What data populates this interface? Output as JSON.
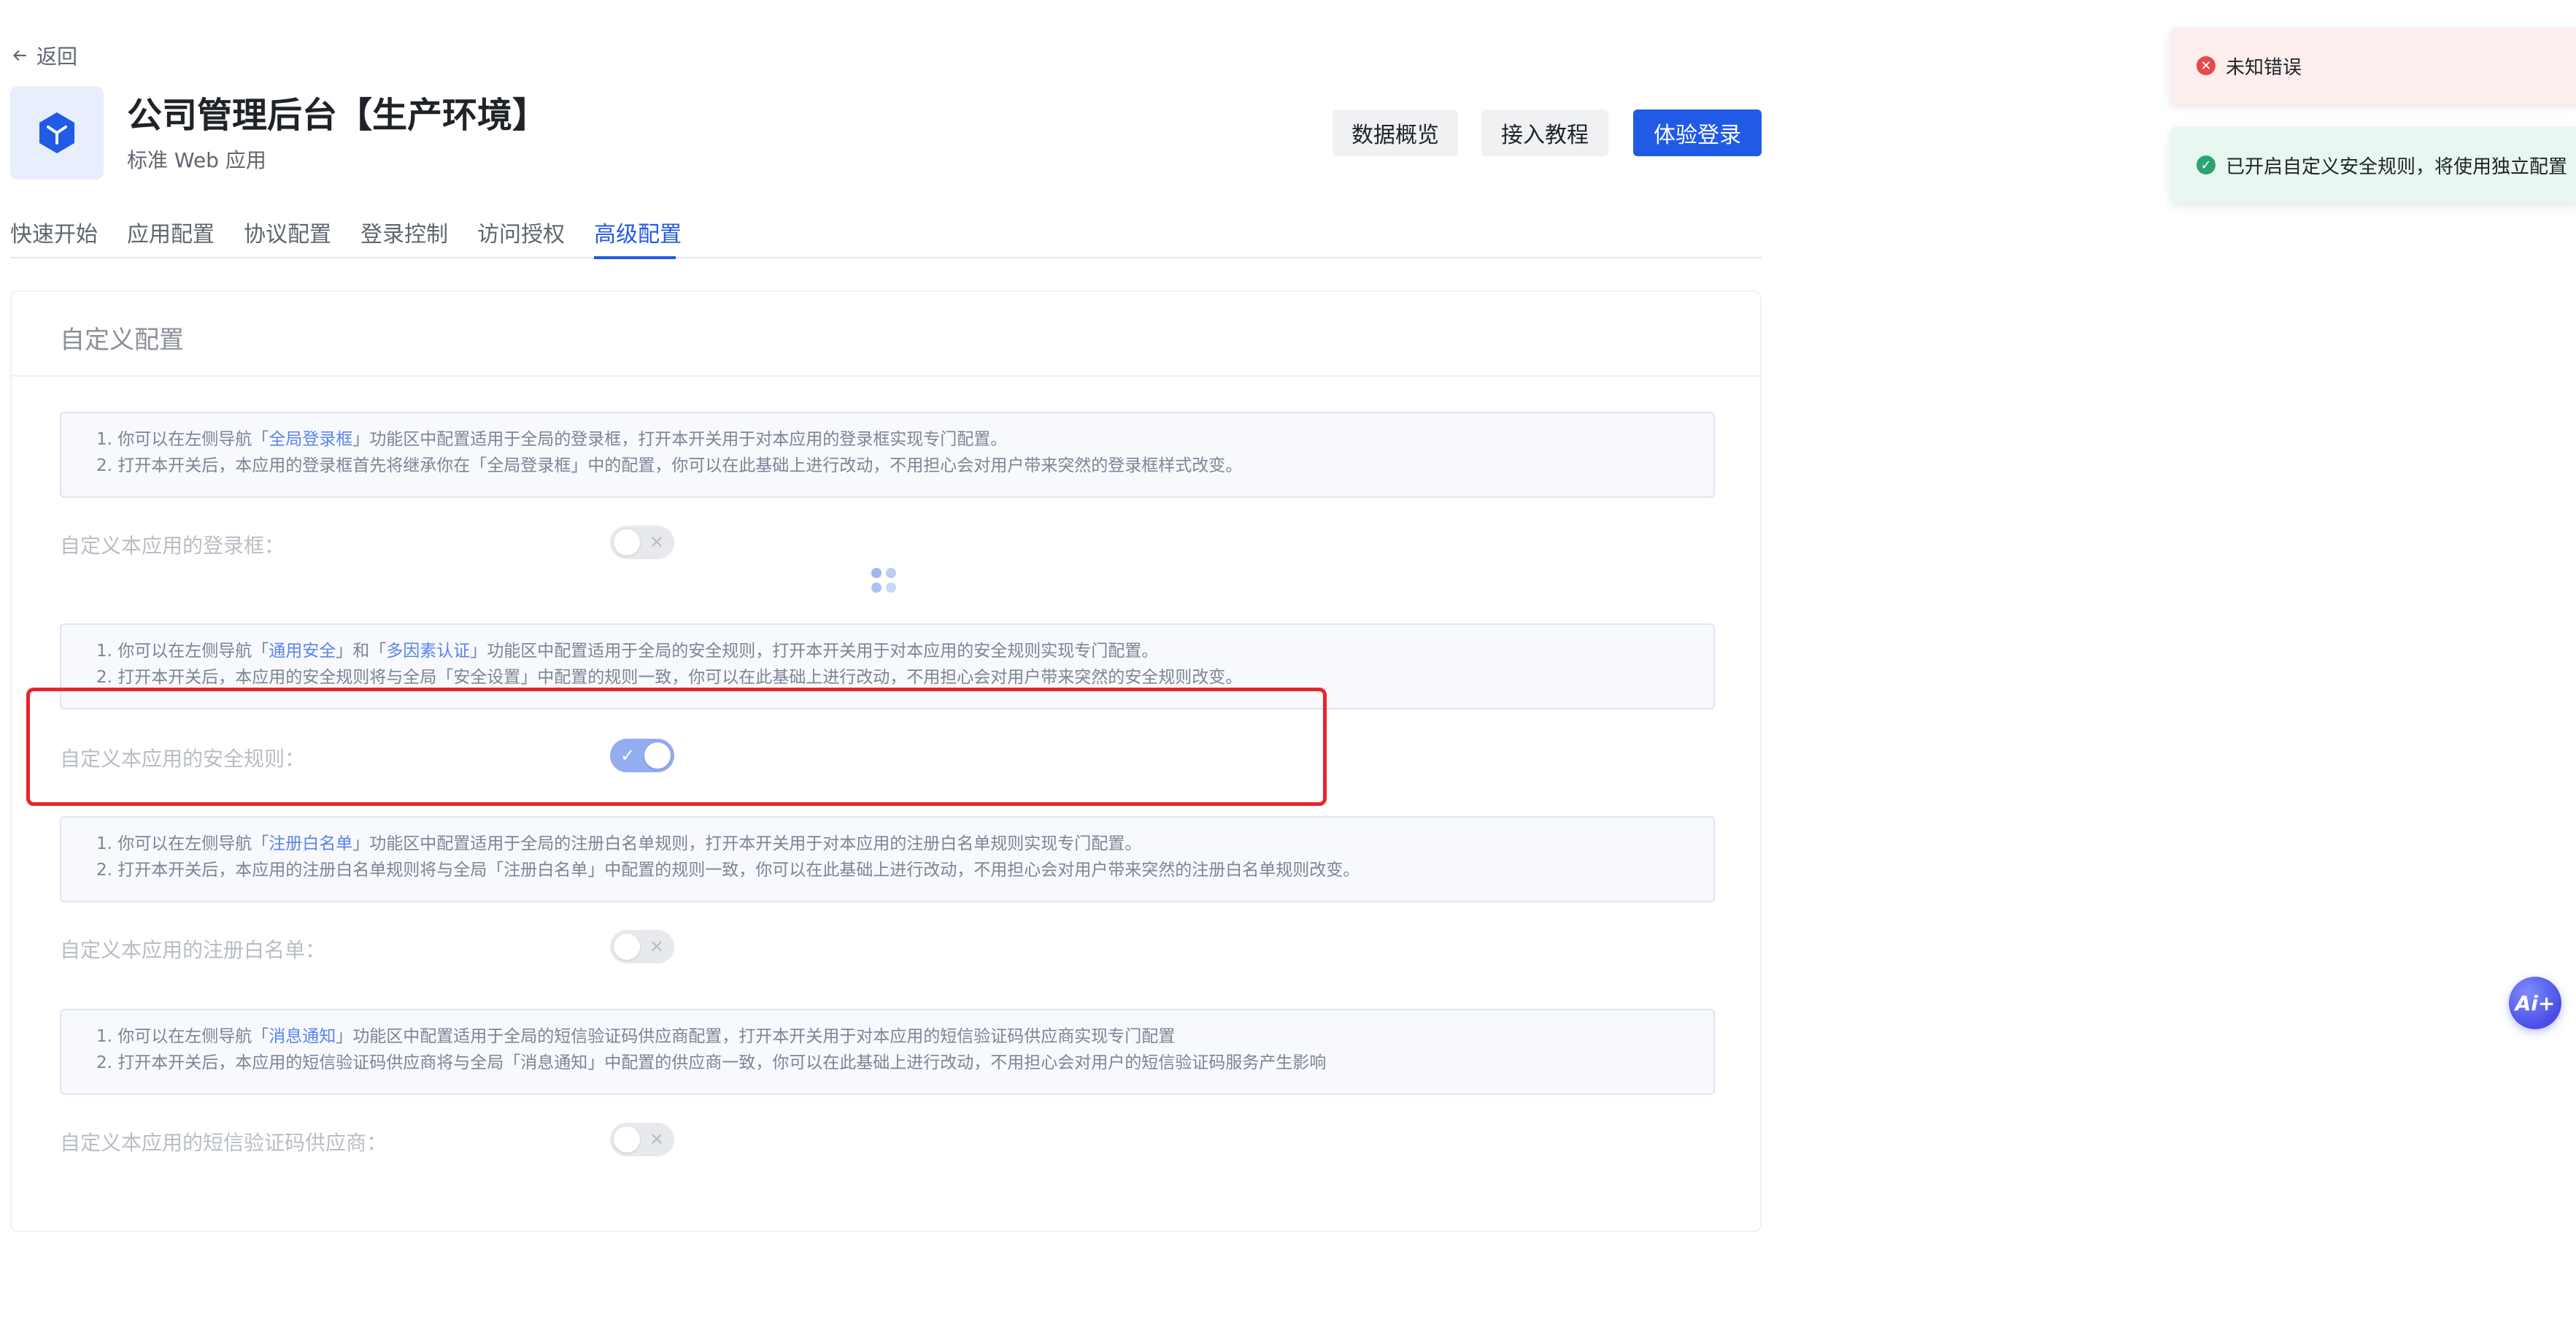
{
  "nav": {
    "back_label": "返回"
  },
  "app": {
    "title": "公司管理后台【生产环境】",
    "subtitle": "标准 Web 应用",
    "accent": "#215ae5"
  },
  "header_buttons": {
    "overview": "数据概览",
    "tutorial": "接入教程",
    "try_login": "体验登录"
  },
  "tabs": [
    {
      "label": "快速开始",
      "active": false
    },
    {
      "label": "应用配置",
      "active": false
    },
    {
      "label": "协议配置",
      "active": false
    },
    {
      "label": "登录控制",
      "active": false
    },
    {
      "label": "访问授权",
      "active": false
    },
    {
      "label": "高级配置",
      "active": true
    }
  ],
  "card": {
    "title": "自定义配置",
    "sections": [
      {
        "info": [
          {
            "prefix": "1. 你可以在左侧导航「",
            "link": "全局登录框",
            "suffix": "」功能区中配置适用于全局的登录框，打开本开关用于对本应用的登录框实现专门配置。"
          },
          {
            "text": "2. 打开本开关后，本应用的登录框首先将继承你在「全局登录框」中的配置，你可以在此基础上进行改动，不用担心会对用户带来突然的登录框样式改变。"
          }
        ],
        "label": "自定义本应用的登录框：",
        "switch_on": false
      },
      {
        "info": [
          {
            "prefix": "1. 你可以在左侧导航「",
            "link": "通用安全",
            "middle": "」和「",
            "link2": "多因素认证",
            "suffix": "」功能区中配置适用于全局的安全规则，打开本开关用于对本应用的安全规则实现专门配置。"
          },
          {
            "text": "2. 打开本开关后，本应用的安全规则将与全局「安全设置」中配置的规则一致，你可以在此基础上进行改动，不用担心会对用户带来突然的安全规则改变。"
          }
        ],
        "label": "自定义本应用的安全规则：",
        "switch_on": true
      },
      {
        "info": [
          {
            "prefix": "1. 你可以在左侧导航「",
            "link": "注册白名单",
            "suffix": "」功能区中配置适用于全局的注册白名单规则，打开本开关用于对本应用的注册白名单规则实现专门配置。"
          },
          {
            "text": "2. 打开本开关后，本应用的注册白名单规则将与全局「注册白名单」中配置的规则一致，你可以在此基础上进行改动，不用担心会对用户带来突然的注册白名单规则改变。"
          }
        ],
        "label": "自定义本应用的注册白名单：",
        "switch_on": false
      },
      {
        "info": [
          {
            "prefix": "1. 你可以在左侧导航「",
            "link": "消息通知",
            "suffix": "」功能区中配置适用于全局的短信验证码供应商配置，打开本开关用于对本应用的短信验证码供应商实现专门配置"
          },
          {
            "text": "2. 打开本开关后，本应用的短信验证码供应商将与全局「消息通知」中配置的供应商一致，你可以在此基础上进行改动，不用担心会对用户的短信验证码服务产生影响"
          }
        ],
        "label": "自定义本应用的短信验证码供应商：",
        "switch_on": false
      }
    ]
  },
  "toasts": {
    "error": "未知错误",
    "success": "已开启自定义安全规则，将使用独立配置"
  },
  "ai_button_label": "Ai+"
}
